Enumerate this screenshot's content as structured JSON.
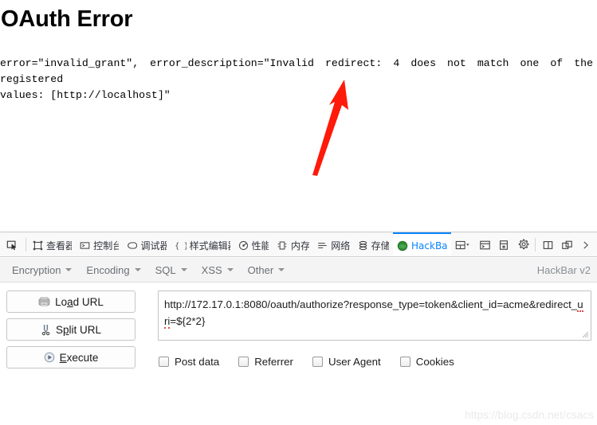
{
  "page": {
    "title": "OAuth Error",
    "error_line1": "error=\"invalid_grant\", error_description=\"Invalid redirect: 4 does not match one of the registered",
    "error_line2": "values: [http://localhost]\""
  },
  "annotation": {
    "arrow_color": "#ff1a09",
    "arrow_name": "red-pointer-arrow"
  },
  "devtools": {
    "picker_icon": "element-picker-icon",
    "tabs": [
      {
        "id": "inspector",
        "label": "查看器",
        "icon": "inspector-icon",
        "active": false
      },
      {
        "id": "console",
        "label": "控制台",
        "icon": "console-icon",
        "active": false
      },
      {
        "id": "debugger",
        "label": "调试器",
        "icon": "debugger-icon",
        "active": false
      },
      {
        "id": "styleeditor",
        "label": "样式编辑器",
        "icon": "style-editor-icon",
        "active": false
      },
      {
        "id": "performance",
        "label": "性能",
        "icon": "performance-icon",
        "active": false
      },
      {
        "id": "memory",
        "label": "内存",
        "icon": "memory-icon",
        "active": false
      },
      {
        "id": "network",
        "label": "网络",
        "icon": "network-icon",
        "active": false
      },
      {
        "id": "storage",
        "label": "存储",
        "icon": "storage-icon",
        "active": false
      },
      {
        "id": "hackbar",
        "label": "HackBar",
        "icon": "hackbar-icon",
        "active": true
      }
    ],
    "right_tools": [
      {
        "id": "split-layout",
        "icon": "split-layout-icon"
      },
      {
        "id": "split-console",
        "icon": "split-console-icon"
      },
      {
        "id": "responsive-mode",
        "icon": "responsive-design-mode-icon"
      },
      {
        "id": "settings",
        "icon": "gear-icon"
      },
      {
        "id": "dock-side",
        "icon": "dock-to-side-icon"
      },
      {
        "id": "separate-window",
        "icon": "separate-window-icon"
      },
      {
        "id": "overflow",
        "icon": "chevron-right-icon"
      }
    ],
    "active_tab_accent": "#0a84ff"
  },
  "hackbar": {
    "menus": [
      {
        "id": "encryption",
        "label": "Encryption"
      },
      {
        "id": "encoding",
        "label": "Encoding"
      },
      {
        "id": "sql",
        "label": "SQL"
      },
      {
        "id": "xss",
        "label": "XSS"
      },
      {
        "id": "other",
        "label": "Other"
      }
    ],
    "version_label": "HackBar v2",
    "buttons": [
      {
        "id": "load-url",
        "pre": "Lo",
        "key": "a",
        "post": "d URL",
        "icon": "load-url-icon"
      },
      {
        "id": "split-url",
        "pre": "S",
        "key": "p",
        "post": "lit URL",
        "icon": "scissors-icon"
      },
      {
        "id": "execute",
        "pre": "",
        "key": "E",
        "post": "xecute",
        "icon": "play-icon"
      }
    ],
    "url_value_part1": "http://172.17.0.1:8080/oauth/authorize?response_type=token&client_id=acme&redirect_",
    "url_value_spell": "uri",
    "url_value_part2": "=${2*2}",
    "url_value_full": "http://172.17.0.1:8080/oauth/authorize?response_type=token&client_id=acme&redirect_uri=${2*2}",
    "checkboxes": [
      {
        "id": "post-data",
        "label": "Post data",
        "checked": false
      },
      {
        "id": "referrer",
        "label": "Referrer",
        "checked": false
      },
      {
        "id": "user-agent",
        "label": "User Agent",
        "checked": false
      },
      {
        "id": "cookies",
        "label": "Cookies",
        "checked": false
      }
    ]
  },
  "watermark": {
    "text": "https://blog.csdn.net/csacs"
  }
}
